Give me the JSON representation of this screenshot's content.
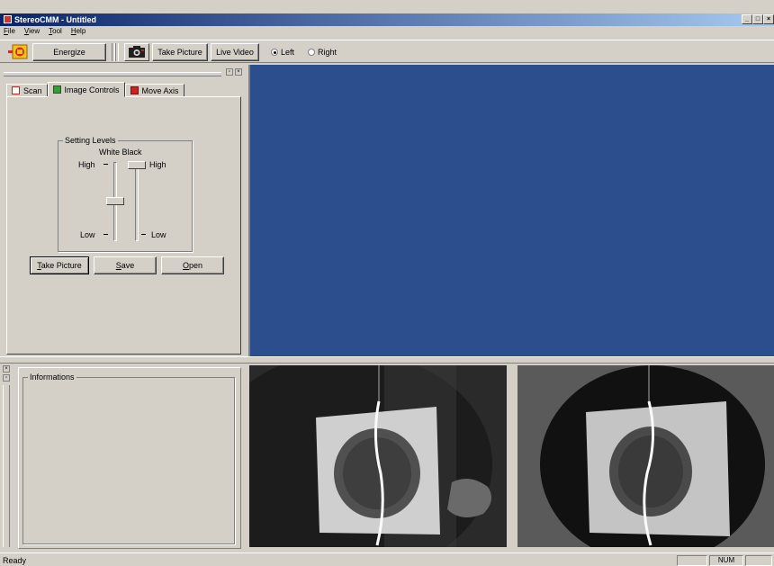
{
  "window": {
    "title": "StereoCMM - Untitled",
    "controls": [
      "_",
      "□",
      "×"
    ]
  },
  "menu": [
    "File",
    "View",
    "Tool",
    "Help"
  ],
  "toolbar": {
    "energize_label": "Energize",
    "take_picture_label": "Take Picture",
    "live_video_label": "Live Video",
    "radio_left_label": "Left",
    "radio_right_label": "Right",
    "selected_side": "Left"
  },
  "left_panel": {
    "tabs": [
      {
        "label": "Scan",
        "icon": "scan-icon"
      },
      {
        "label": "Image Controls",
        "icon": "image-controls-icon"
      },
      {
        "label": "Move Axis",
        "icon": "move-axis-icon"
      }
    ],
    "active_tab": "Image Controls",
    "setting_levels": {
      "caption": "Setting Levels",
      "header": "White Black",
      "high_left": "High",
      "high_right": "High",
      "low_left": "Low",
      "low_right": "Low",
      "white_level": 0.5,
      "black_level": 1.0
    },
    "buttons": {
      "take_picture": "Take Picture",
      "save": "Save",
      "open": "Open"
    }
  },
  "info_panel": {
    "caption": "Informations"
  },
  "status": {
    "text": "Ready",
    "num": "NUM"
  },
  "colors": {
    "title_start": "#0a246a",
    "title_end": "#a6caf0",
    "view_bg": "#2d4e8c",
    "chrome": "#d4d0c8"
  }
}
